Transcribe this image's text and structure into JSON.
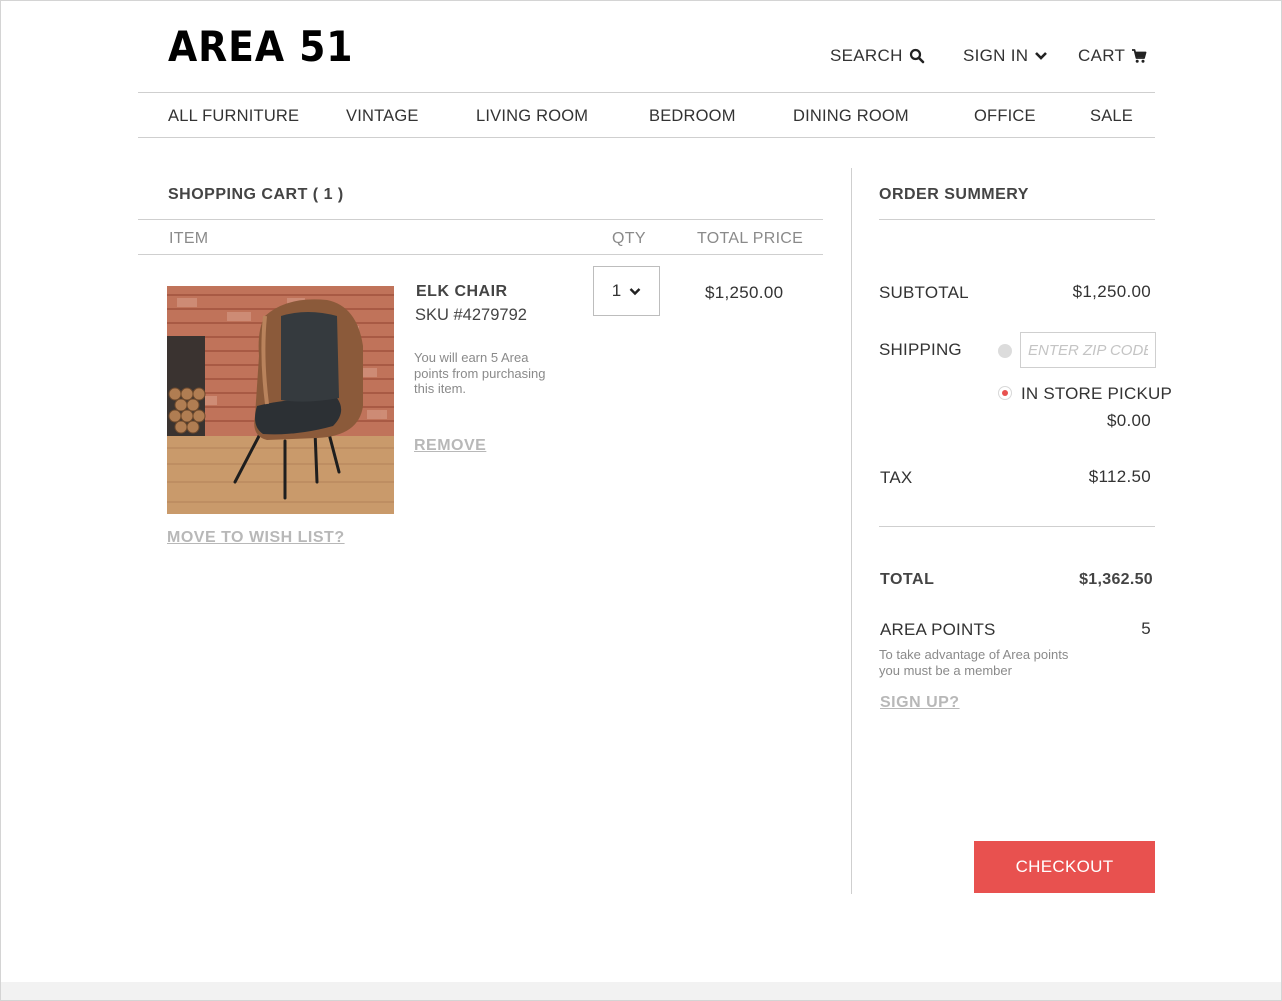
{
  "brand": {
    "logo": "AREA 51"
  },
  "header": {
    "search_label": "SEARCH",
    "signin_label": "SIGN IN",
    "cart_label": "CART"
  },
  "nav": {
    "items": [
      "ALL FURNITURE",
      "VINTAGE",
      "LIVING ROOM",
      "BEDROOM",
      "DINING ROOM",
      "OFFICE",
      "SALE"
    ]
  },
  "cart": {
    "title": "SHOPPING CART ( 1 )",
    "columns": {
      "item": "ITEM",
      "qty": "QTY",
      "total_price": "TOTAL PRICE"
    },
    "items": [
      {
        "name": "ELK CHAIR",
        "sku": "SKU #4279792",
        "note": "You will earn 5 Area points from purchasing this item.",
        "remove_label": "REMOVE",
        "qty": "1",
        "total_price": "$1,250.00"
      }
    ],
    "wishlist_label": "MOVE TO WISH LIST?"
  },
  "summary": {
    "title": "ORDER SUMMERY",
    "subtotal_label": "SUBTOTAL",
    "subtotal_value": "$1,250.00",
    "shipping_label": "SHIPPING",
    "zip_placeholder": "ENTER ZIP CODE",
    "pickup_label": "IN STORE PICKUP",
    "pickup_value": "$0.00",
    "tax_label": "TAX",
    "tax_value": "$112.50",
    "total_label": "TOTAL",
    "total_value": "$1,362.50",
    "points_label": "AREA POINTS",
    "points_value": "5",
    "points_note": "To take advantage of Area points you must be a member",
    "signup_label": "SIGN UP?",
    "checkout_label": "CHECKOUT"
  },
  "colors": {
    "accent": "#e8514f",
    "text": "#333333",
    "muted": "#8a8a8a",
    "link_muted": "#b8b8b8",
    "rule": "#cfcfcf"
  }
}
